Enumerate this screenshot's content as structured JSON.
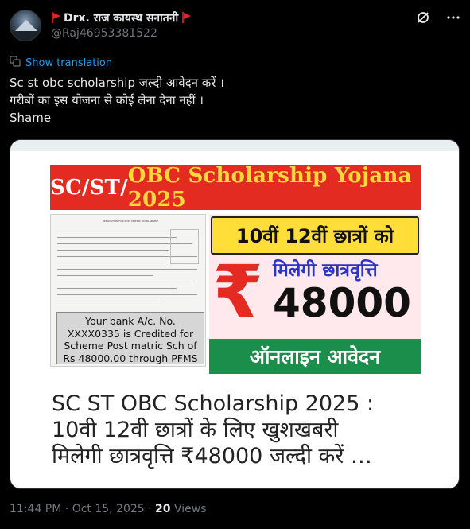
{
  "author": {
    "display_name": "Drx. राज कायस्थ सनातनी",
    "handle": "@Raj46953381522",
    "avatar_icon": "avatar-image",
    "flag_icon": "red-flag-icon"
  },
  "header_icons": [
    "grok-icon",
    "more-icon"
  ],
  "show_translation": "Show translation",
  "tweet_lines": [
    "Sc st obc scholarship जल्दी आवेदन करें ।",
    "गरीबों का इस योजना से कोई लेना देना नहीं ।",
    "Shame"
  ],
  "media": {
    "banner_prefix": "SC/ST/",
    "banner_highlight": "OBC Scholarship Yojana 2025",
    "doc_title": "APPLICATION FOR POST MATRIC SCHOLARSHIP",
    "bank_lines": [
      "Your bank A/c. No.",
      "XXXX0335 is Credited for",
      "Scheme Post matric Sch of",
      "Rs 48000.00 through PFMS"
    ],
    "class_text": "10वीं 12वीं छात्रों को",
    "rupee": "₹",
    "milegi": "मिलेगी छात्रवृत्ति",
    "amount": "48000",
    "online": "ऑनलाइन आवेदन",
    "headline_lines": [
      "SC ST OBC Scholarship 2025 :",
      "10वी 12वी छात्रों के लिए खुशखबरी",
      "मिलेगी छात्रवृत्ति ₹48000 जल्दी करें …"
    ]
  },
  "meta": {
    "time": "11:44 PM",
    "date": "Oct 15, 2025",
    "views_count": "20",
    "views_label": "Views"
  },
  "colors": {
    "link": "#1d9bf0",
    "banner_red": "#e32b22",
    "banner_yellow_text": "#ffd93b",
    "green": "#1c8e4b",
    "yellow": "#ffde3a"
  }
}
